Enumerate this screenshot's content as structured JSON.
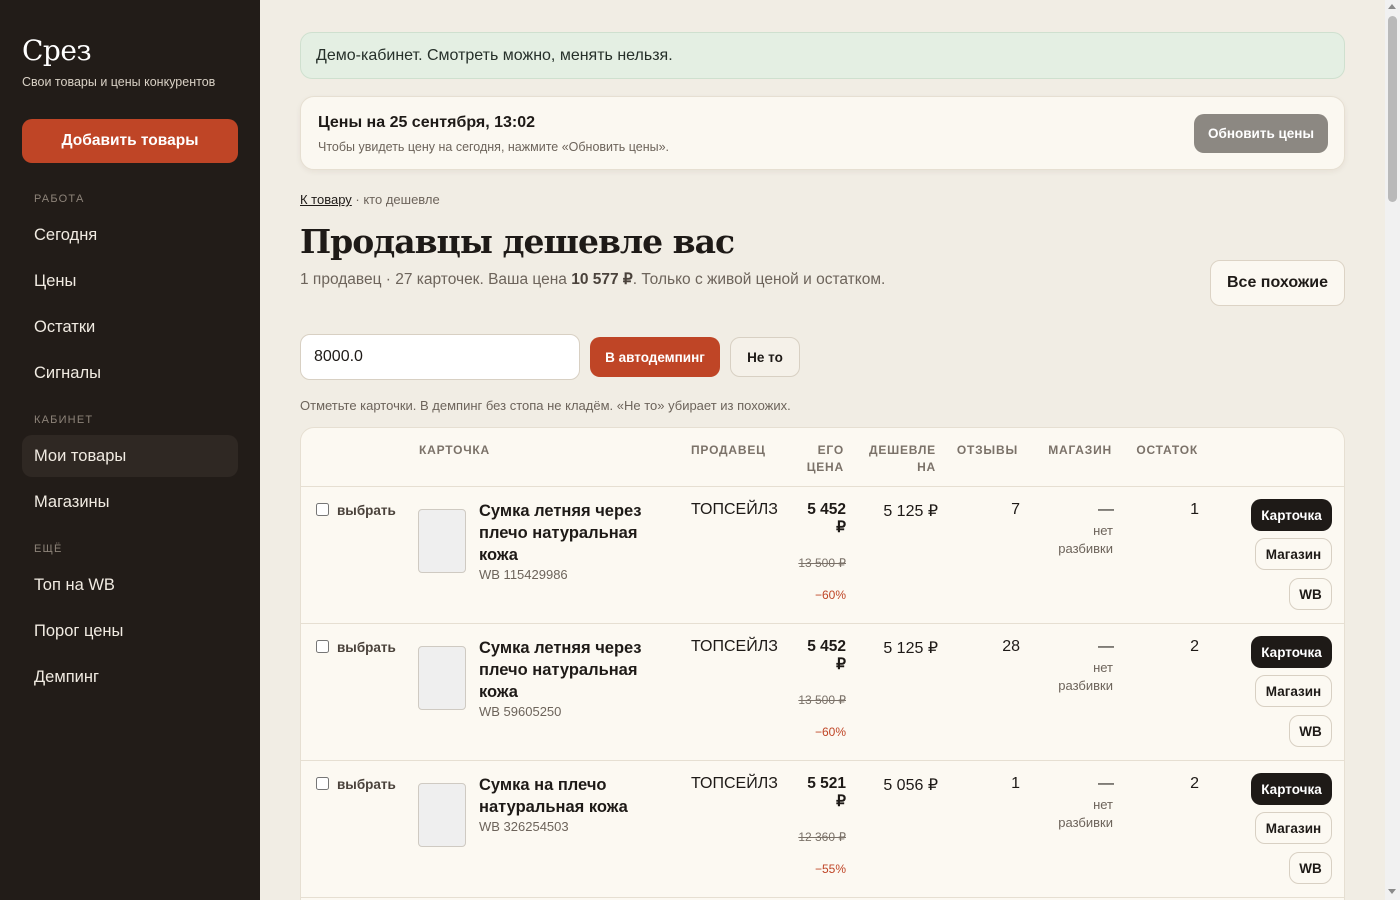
{
  "sidebar": {
    "brand": "Срез",
    "brand_sub": "Свои товары и цены конкурентов",
    "add_button": "Добавить товары",
    "sections": {
      "work": "Работа",
      "cabinet": "Кабинет",
      "more": "Ещё"
    },
    "items": {
      "today": "Сегодня",
      "prices": "Цены",
      "stock": "Остатки",
      "signals": "Сигналы",
      "my_goods": "Мои товары",
      "shops": "Магазины",
      "top_wb": "Топ на WB",
      "threshold": "Порог цены",
      "dumping": "Демпинг"
    }
  },
  "banner": {
    "text": "Демо-кабинет. Смотреть можно, менять нельзя."
  },
  "prices_card": {
    "title": "Цены на 25 сентября, 13:02",
    "subtitle": "Чтобы увидеть цену на сегодня, нажмите «Обновить цены».",
    "refresh_button": "Обновить цены"
  },
  "breadcrumb": {
    "link": "К товару",
    "rest": " · кто дешевле"
  },
  "page": {
    "title": "Продавцы дешевле вас",
    "sub_before": "1 продавец · 27 карточек. Ваша цена ",
    "sub_price": "10 577 ₽",
    "sub_after": ". Только с живой ценой и остатком.",
    "similar_button": "Все похожие"
  },
  "controls": {
    "price_value": "8000.0",
    "dump_button": "В автодемпинг",
    "notthat_button": "Не то",
    "hint": "Отметьте карточки. В демпинг без стопа не кладём. «Не то» убирает из похожих."
  },
  "table": {
    "headers": {
      "card": "КАРТОЧКА",
      "seller": "ПРОДАВЕЦ",
      "his_price": "ЕГО ЦЕНА",
      "cheaper": "ДЕШЕВЛЕ НА",
      "reviews": "ОТЗЫВЫ",
      "store": "МАГАЗИН",
      "stock": "ОСТАТОК"
    },
    "select_label": "выбрать",
    "actions": {
      "card": "Карточка",
      "store": "Магазин",
      "wb": "WB"
    },
    "rows": [
      {
        "name": "Сумка летняя через плечо натуральная кожа",
        "wb_id": "WB 115429986",
        "seller": "ТОПСЕЙЛЗ",
        "his_price": "5 452 ₽",
        "old_price": "13 500 ₽",
        "discount": "−60%",
        "cheaper": "5 125 ₽",
        "reviews": "7",
        "store_dash": "—",
        "store_note": "нет разбивки",
        "stock": "1"
      },
      {
        "name": "Сумка летняя через плечо натуральная кожа",
        "wb_id": "WB 59605250",
        "seller": "ТОПСЕЙЛЗ",
        "his_price": "5 452 ₽",
        "old_price": "13 500 ₽",
        "discount": "−60%",
        "cheaper": "5 125 ₽",
        "reviews": "28",
        "store_dash": "—",
        "store_note": "нет разбивки",
        "stock": "2"
      },
      {
        "name": "Сумка на плечо натуральная кожа",
        "wb_id": "WB 326254503",
        "seller": "ТОПСЕЙЛЗ",
        "his_price": "5 521 ₽",
        "old_price": "12 360 ₽",
        "discount": "−55%",
        "cheaper": "5 056 ₽",
        "reviews": "1",
        "store_dash": "—",
        "store_note": "нет разбивки",
        "stock": "2"
      }
    ]
  },
  "colors": {
    "accent": "#bf4526",
    "sidebar_bg": "#221c18",
    "page_bg": "#f1ede4",
    "banner_bg": "#e4efe3"
  }
}
